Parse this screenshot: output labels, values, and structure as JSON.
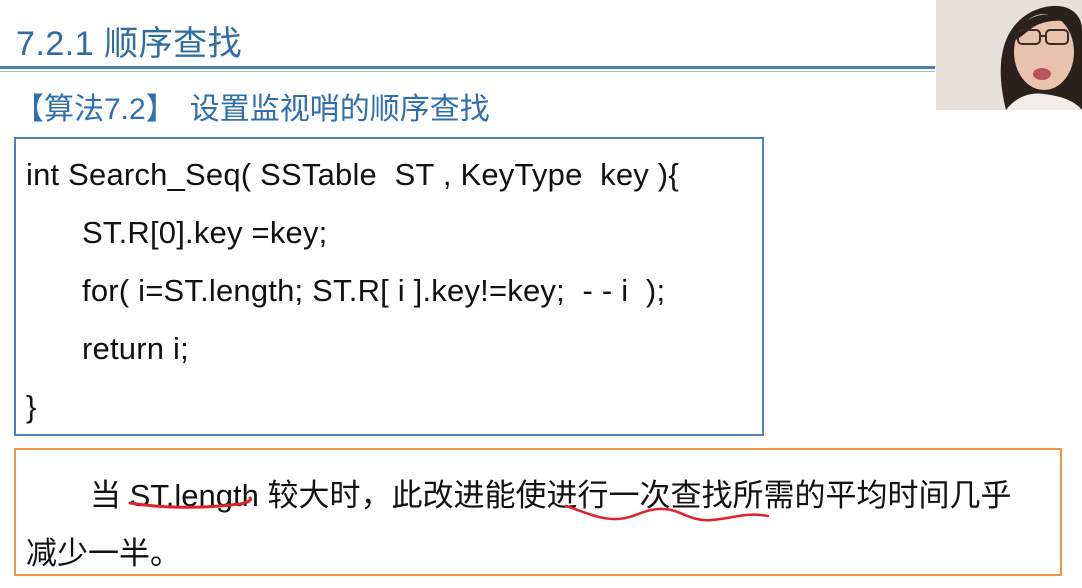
{
  "header": {
    "section_title": "7.2.1 顺序查找"
  },
  "algorithm": {
    "tag": "【算法7.2】",
    "title": "设置监视哨的顺序查找"
  },
  "code": {
    "lines": [
      "int Search_Seq( SSTable  ST , KeyType  key ){",
      "ST.R[0].key =key;",
      "for( i=ST.length; ST.R[ i ].key!=key;  - - i  );",
      "return i;",
      "}"
    ]
  },
  "note": {
    "lead": "当 ",
    "highlight": "ST.length",
    "rest": " 较大时，此改进能使进行一次查找所需的平均时间几乎",
    "line2": "减少一半。"
  },
  "colors": {
    "title_blue": "#2e6da4",
    "code_border": "#4f81bd",
    "note_border": "#f0954a",
    "annotation_red": "#e0222a"
  },
  "icons": {
    "webcam": "presenter-webcam"
  }
}
